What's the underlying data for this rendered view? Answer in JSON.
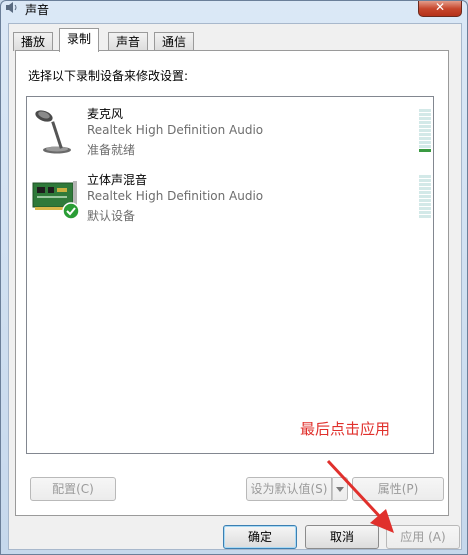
{
  "window": {
    "title": "声音",
    "close_label": "✕",
    "icon": "speaker-icon"
  },
  "tabs": [
    {
      "label": "播放",
      "active": false
    },
    {
      "label": "录制",
      "active": true
    },
    {
      "label": "声音",
      "active": false
    },
    {
      "label": "通信",
      "active": false
    }
  ],
  "panel": {
    "instruction": "选择以下录制设备来修改设置:"
  },
  "devices": [
    {
      "name": "麦克风",
      "driver": "Realtek High Definition Audio",
      "status": "准备就绪",
      "icon": "microphone-icon",
      "level_segments_lit": 1,
      "is_default": false
    },
    {
      "name": "立体声混音",
      "driver": "Realtek High Definition Audio",
      "status": "默认设备",
      "icon": "sound-card-icon",
      "level_segments_lit": 0,
      "is_default": true
    }
  ],
  "buttons": {
    "configure": "配置(C)",
    "set_default": "设为默认值(S)",
    "properties": "属性(P)",
    "ok": "确定",
    "cancel": "取消",
    "apply": "应用 (A)"
  },
  "annotation": {
    "text": "最后点击应用",
    "color": "#e0302c"
  }
}
